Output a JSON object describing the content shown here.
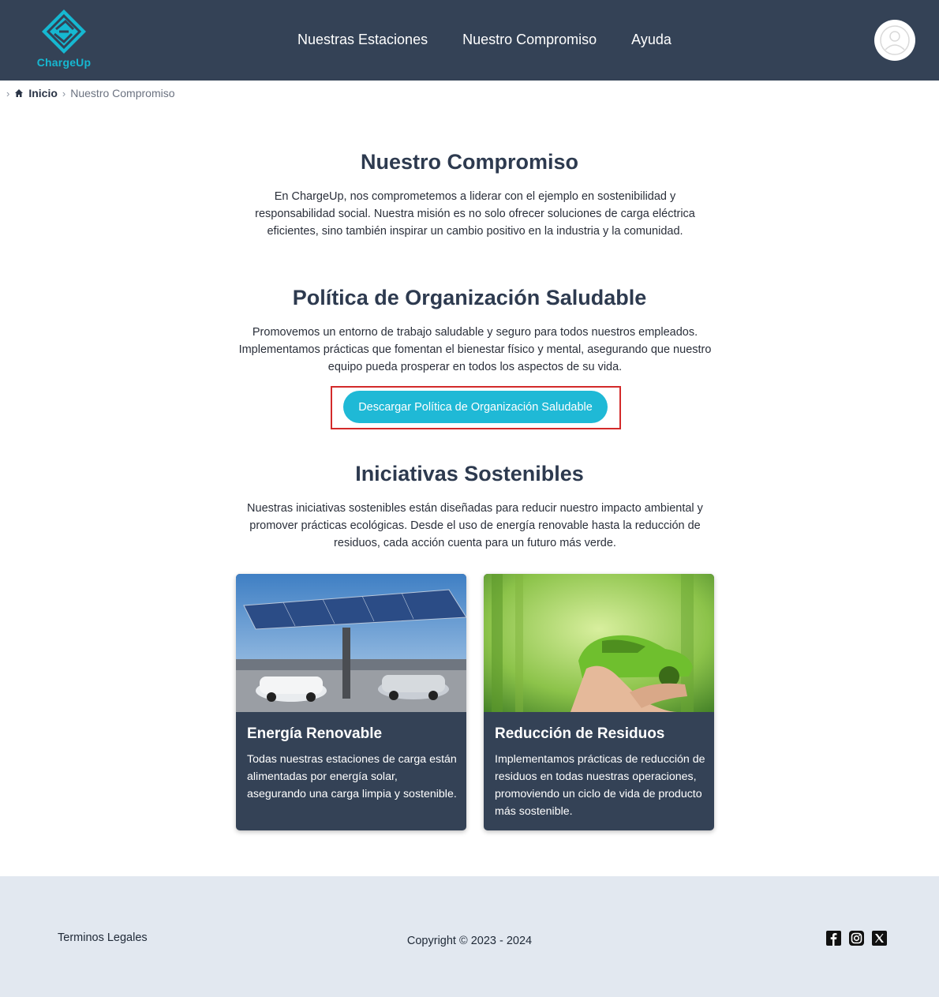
{
  "header": {
    "logo_text": "ChargeUp",
    "nav": [
      "Nuestras Estaciones",
      "Nuestro Compromiso",
      "Ayuda"
    ]
  },
  "breadcrumb": {
    "home": "Inicio",
    "current": "Nuestro Compromiso"
  },
  "commitment": {
    "title": "Nuestro Compromiso",
    "text": "En ChargeUp, nos comprometemos a liderar con el ejemplo en sostenibilidad y responsabilidad social. Nuestra misión es no solo ofrecer soluciones de carga eléctrica eficientes, sino también inspirar un cambio positivo en la industria y la comunidad."
  },
  "policy": {
    "title": "Política de Organización Saludable",
    "text": "Promovemos un entorno de trabajo saludable y seguro para todos nuestros empleados. Implementamos prácticas que fomentan el bienestar físico y mental, asegurando que nuestro equipo pueda prosperar en todos los aspectos de su vida.",
    "button": "Descargar Política de Organización Saludable"
  },
  "initiatives": {
    "title": "Iniciativas Sostenibles",
    "text": "Nuestras iniciativas sostenibles están diseñadas para reducir nuestro impacto ambiental y promover prácticas ecológicas. Desde el uso de energía renovable hasta la reducción de residuos, cada acción cuenta para un futuro más verde.",
    "cards": [
      {
        "title": "Energía Renovable",
        "text": "Todas nuestras estaciones de carga están alimentadas por energía solar, asegurando una carga limpia y sostenible."
      },
      {
        "title": "Reducción de Residuos",
        "text": "Implementamos prácticas de reducción de residuos en todas nuestras operaciones, promoviendo un ciclo de vida de producto más sostenible."
      }
    ]
  },
  "footer": {
    "legal": "Terminos Legales",
    "copyright": "Copyright © 2023 - 2024",
    "social": [
      "facebook-icon",
      "instagram-icon",
      "x-icon"
    ]
  },
  "colors": {
    "header_bg": "#344256",
    "accent": "#1fb9d6",
    "footer_bg": "#e2e8f0"
  }
}
